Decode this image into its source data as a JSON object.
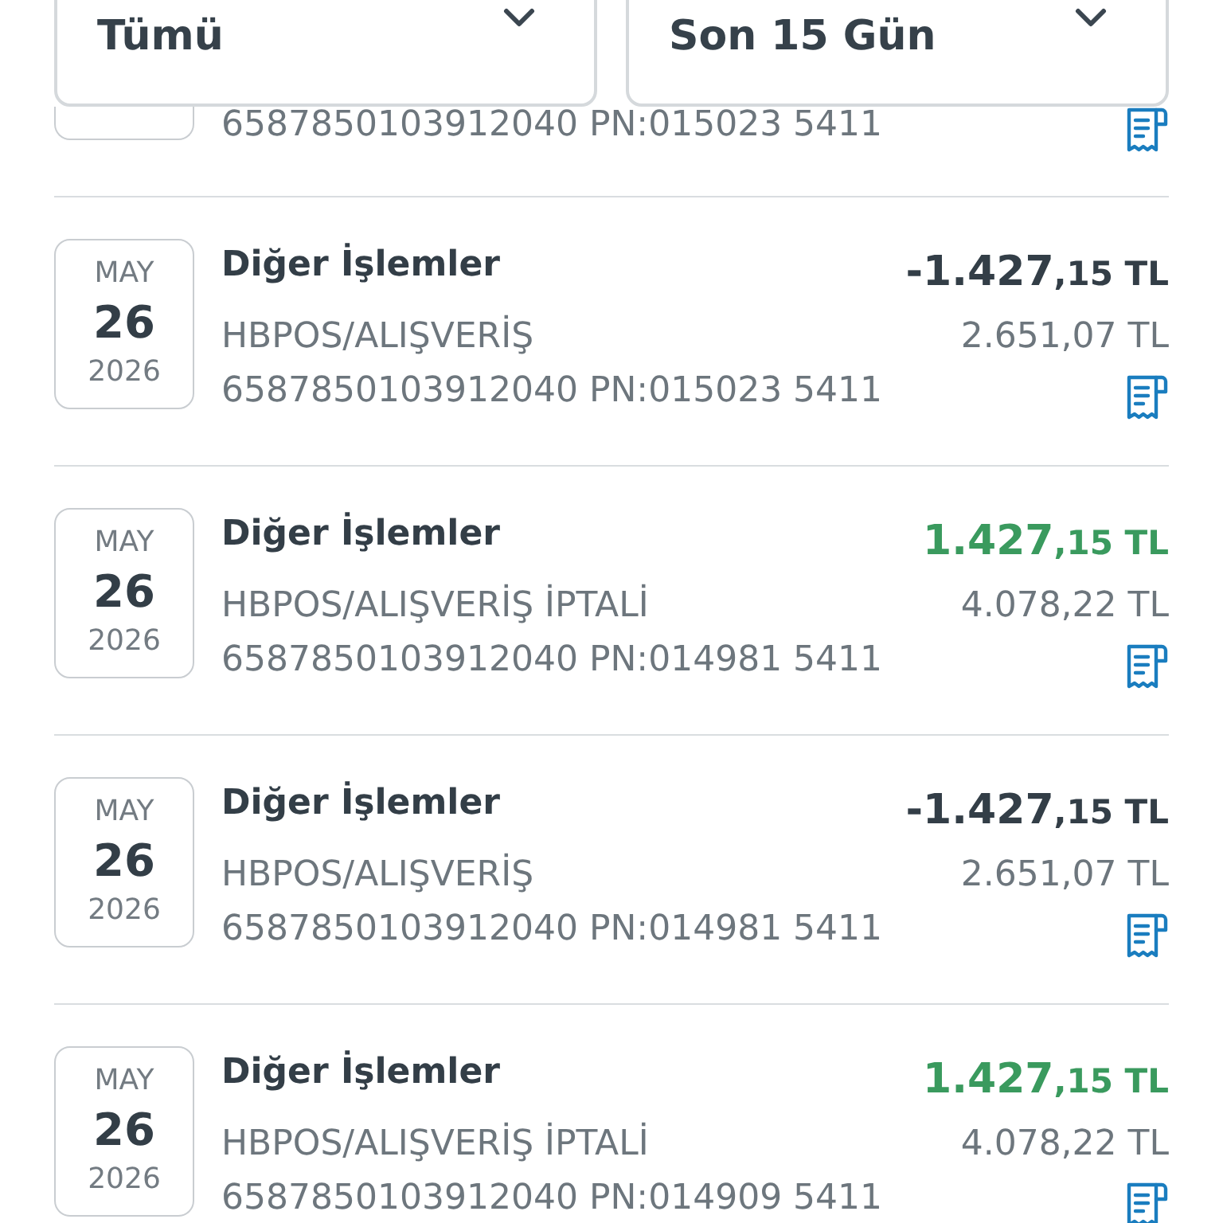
{
  "filters": [
    {
      "value": "Tümü"
    },
    {
      "value": "Son 15 Gün"
    }
  ],
  "transactions": [
    {
      "kind": "cut",
      "reference": "6587850103912040 PN:015023 5411"
    },
    {
      "kind": "full",
      "month": "MAY",
      "day": "26",
      "year": "2026",
      "title": "Diğer İşlemler",
      "description": "HBPOS/ALIŞVERİŞ",
      "reference": "6587850103912040 PN:015023 5411",
      "amount": "**-1.427**,15 TL",
      "credit": false,
      "balance": "2.651,07 TL"
    },
    {
      "kind": "full",
      "month": "MAY",
      "day": "26",
      "year": "2026",
      "title": "Diğer İşlemler",
      "description": "HBPOS/ALIŞVERİŞ İPTALİ",
      "reference": "6587850103912040 PN:014981 5411",
      "amount": "**1.427**,15 TL",
      "credit": true,
      "balance": "4.078,22 TL"
    },
    {
      "kind": "full",
      "month": "MAY",
      "day": "26",
      "year": "2026",
      "title": "Diğer İşlemler",
      "description": "HBPOS/ALIŞVERİŞ",
      "reference": "6587850103912040 PN:014981 5411",
      "amount": "**-1.427**,15 TL",
      "credit": false,
      "balance": "2.651,07 TL"
    },
    {
      "kind": "full",
      "month": "MAY",
      "day": "26",
      "year": "2026",
      "title": "Diğer İşlemler",
      "description": "HBPOS/ALIŞVERİŞ İPTALİ",
      "reference": "6587850103912040 PN:014909 5411",
      "amount": "**1.427**,15 TL",
      "credit": true,
      "balance": "4.078,22 TL"
    }
  ]
}
